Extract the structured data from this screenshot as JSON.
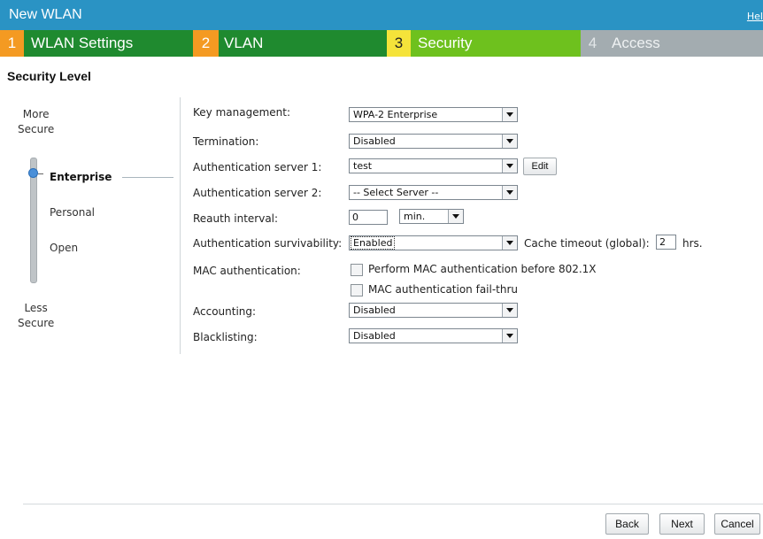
{
  "window": {
    "title": "New WLAN",
    "help": "Hel"
  },
  "steps": [
    {
      "num": "1",
      "label": "WLAN Settings"
    },
    {
      "num": "2",
      "label": "VLAN"
    },
    {
      "num": "3",
      "label": "Security"
    },
    {
      "num": "4",
      "label": "Access"
    }
  ],
  "section_title": "Security Level",
  "slider": {
    "top_label": "More\nSecure",
    "bottom_label": "Less\nSecure",
    "levels": [
      "Enterprise",
      "Personal",
      "Open"
    ],
    "selected": "Enterprise"
  },
  "form": {
    "key_management": {
      "label": "Key management:",
      "value": "WPA-2 Enterprise"
    },
    "termination": {
      "label": "Termination:",
      "value": "Disabled"
    },
    "auth_server_1": {
      "label": "Authentication server 1:",
      "value": "test",
      "edit": "Edit"
    },
    "auth_server_2": {
      "label": "Authentication server 2:",
      "value": "-- Select Server --"
    },
    "reauth": {
      "label": "Reauth interval:",
      "value": "0",
      "unit": "min."
    },
    "survivability": {
      "label": "Authentication survivability:",
      "value": "Enabled",
      "cache_label": "Cache timeout (global):",
      "cache_value": "2",
      "cache_unit": "hrs."
    },
    "mac_auth": {
      "label": "MAC authentication:",
      "opt1": "Perform MAC authentication before 802.1X",
      "opt2": "MAC authentication fail-thru"
    },
    "accounting": {
      "label": "Accounting:",
      "value": "Disabled"
    },
    "blacklisting": {
      "label": "Blacklisting:",
      "value": "Disabled"
    }
  },
  "footer": {
    "back": "Back",
    "next": "Next",
    "cancel": "Cancel"
  }
}
